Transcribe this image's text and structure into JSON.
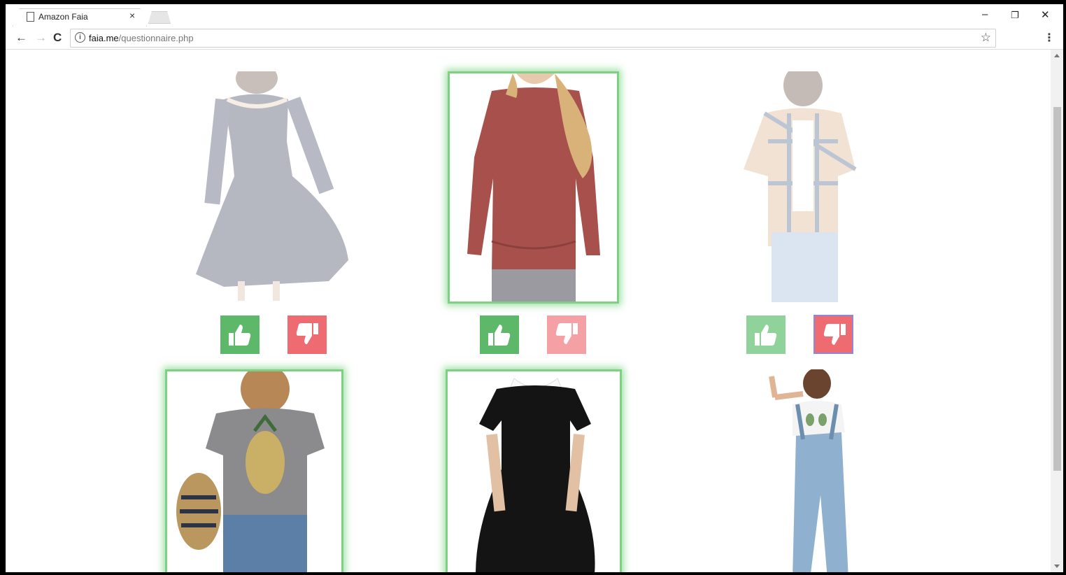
{
  "browser": {
    "tab_title": "Amazon Faia",
    "tab_close": "×",
    "url_host": "faia.me",
    "url_path": "/questionnaire.php",
    "icons": {
      "back": "arrow-left-icon",
      "forward": "arrow-right-icon",
      "reload": "reload-icon",
      "info": "info-icon",
      "bookmark": "star-icon",
      "menu": "kebab-menu-icon",
      "minimize": "minimize-icon",
      "restore": "restore-icon",
      "close": "close-icon"
    },
    "glyphs": {
      "back": "←",
      "forward": "→",
      "reload": "C",
      "info": "i",
      "star": "☆",
      "menu": "⋮",
      "minimize": "–",
      "restore": "❐",
      "close": "✕"
    }
  },
  "colors": {
    "like": "#5db86a",
    "dislike": "#ef6b72",
    "selected_glow": "#7fcf85"
  },
  "items": [
    {
      "id": "lace-dress",
      "description": "navy lace off-shoulder dress",
      "state": "dimmed"
    },
    {
      "id": "red-long-sleeve-top",
      "description": "rust red long sleeve pocket top",
      "state": "selected-like"
    },
    {
      "id": "plaid-shirt",
      "description": "plaid button shirt",
      "state": "dimmed-disliked"
    },
    {
      "id": "pineapple-tee",
      "description": "grey pineapple t-shirt",
      "state": "selected"
    },
    {
      "id": "collar-dress",
      "description": "black dress with white collar",
      "state": "selected"
    },
    {
      "id": "alien-crop-overalls",
      "description": "alien crop top with denim overalls",
      "state": "normal"
    }
  ]
}
